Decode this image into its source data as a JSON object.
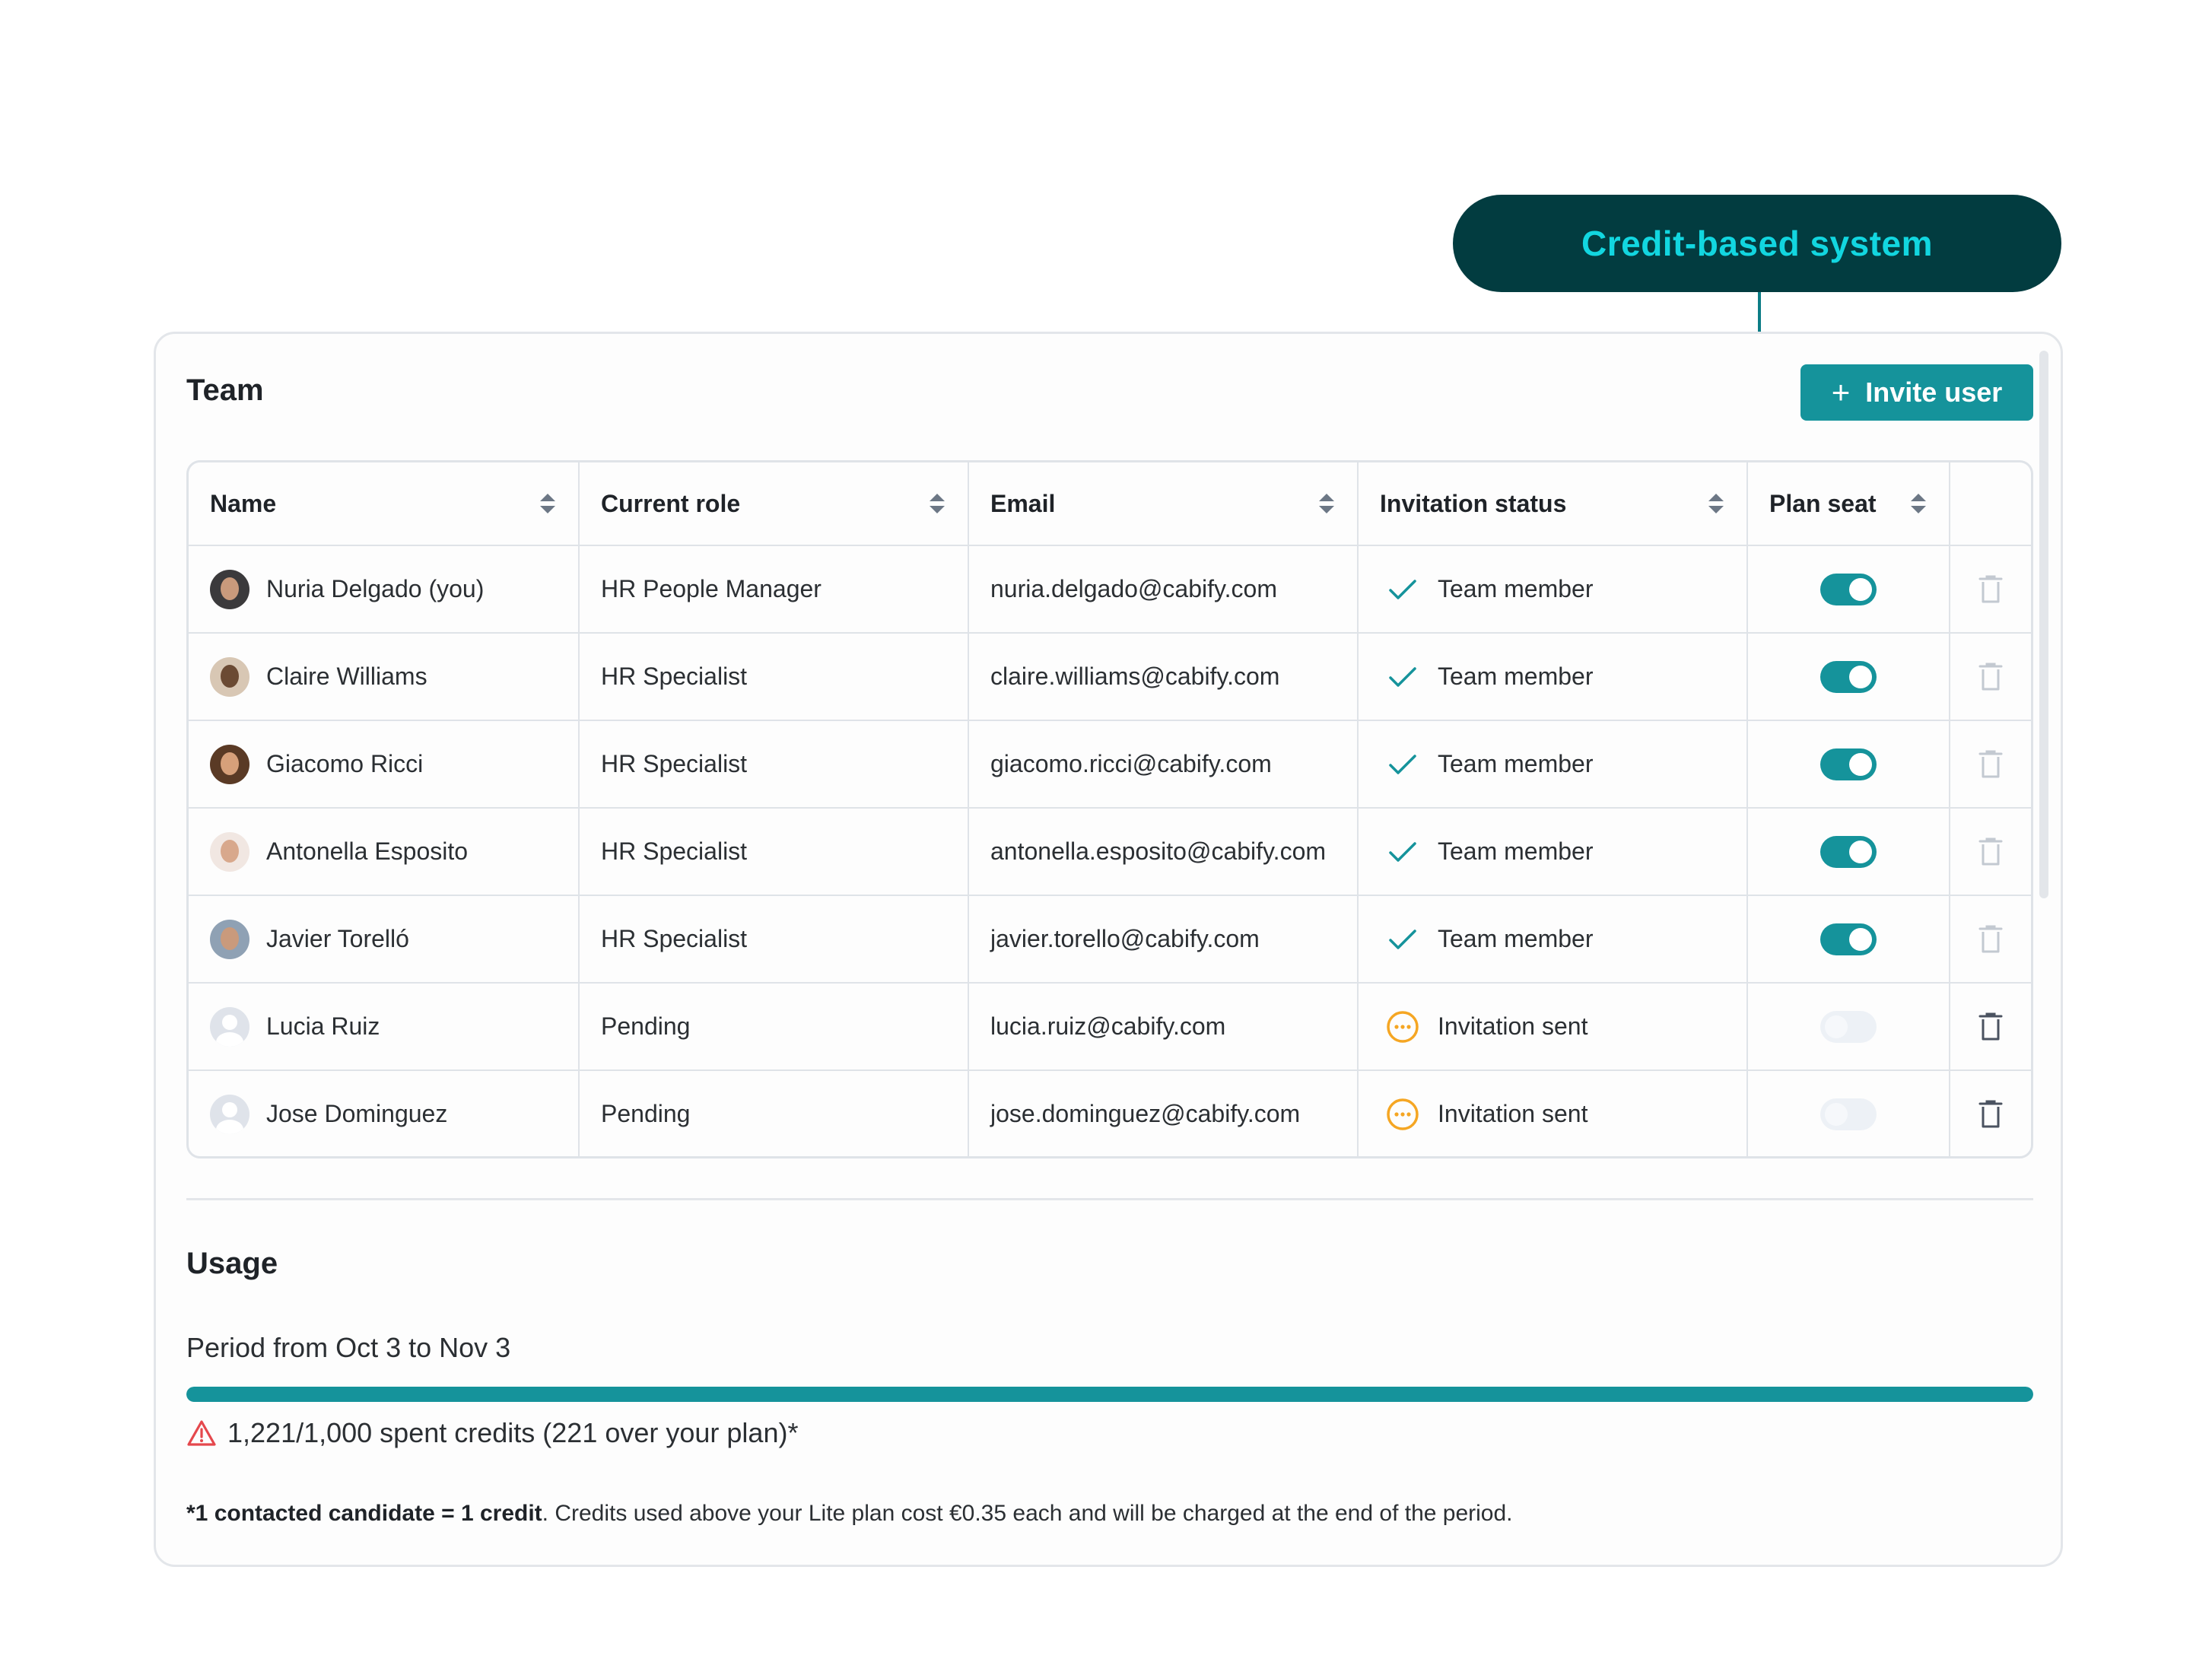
{
  "callout": {
    "label": "Credit-based system"
  },
  "team": {
    "title": "Team",
    "invite_button": {
      "icon": "plus-icon",
      "label": "Invite user"
    },
    "columns": [
      "Name",
      "Current role",
      "Email",
      "Invitation status",
      "Plan seat"
    ],
    "rows": [
      {
        "name": "Nuria Delgado (you)",
        "role": "HR People Manager",
        "email": "nuria.delgado@cabify.com",
        "status": "Team member",
        "status_icon": "check-icon",
        "plan_seat": true,
        "avatar": "photo"
      },
      {
        "name": "Claire Williams",
        "role": "HR Specialist",
        "email": "claire.williams@cabify.com",
        "status": "Team member",
        "status_icon": "check-icon",
        "plan_seat": true,
        "avatar": "photo"
      },
      {
        "name": "Giacomo Ricci",
        "role": "HR Specialist",
        "email": "giacomo.ricci@cabify.com",
        "status": "Team member",
        "status_icon": "check-icon",
        "plan_seat": true,
        "avatar": "photo"
      },
      {
        "name": "Antonella Esposito",
        "role": "HR Specialist",
        "email": "antonella.esposito@cabify.com",
        "status": "Team member",
        "status_icon": "check-icon",
        "plan_seat": true,
        "avatar": "photo"
      },
      {
        "name": "Javier Torelló",
        "role": "HR Specialist",
        "email": "javier.torello@cabify.com",
        "status": "Team member",
        "status_icon": "check-icon",
        "plan_seat": true,
        "avatar": "photo"
      },
      {
        "name": "Lucia Ruiz",
        "role": "Pending",
        "email": "lucia.ruiz@cabify.com",
        "status": "Invitation sent",
        "status_icon": "pending-dots-icon",
        "plan_seat": false,
        "avatar": "placeholder"
      },
      {
        "name": "Jose Dominguez",
        "role": "Pending",
        "email": "jose.dominguez@cabify.com",
        "status": "Invitation sent",
        "status_icon": "pending-dots-icon",
        "plan_seat": false,
        "avatar": "placeholder"
      }
    ]
  },
  "usage": {
    "title": "Usage",
    "period": "Period from Oct 3 to Nov 3",
    "progress_fraction": 1.0,
    "spent_text": "1,221/1,000 spent credits (221 over your plan)*",
    "warning_icon": "warning-triangle-icon",
    "footnote_bold": "*1 contacted candidate = 1 credit",
    "footnote_rest": ". Credits used above your Lite plan cost €0.35 each and will be charged at the end of the period."
  },
  "colors": {
    "accent": "#15939b",
    "callout_bg": "#023c40",
    "callout_text": "#12d6e0",
    "pending": "#f5a623",
    "warning": "#e5484d"
  }
}
